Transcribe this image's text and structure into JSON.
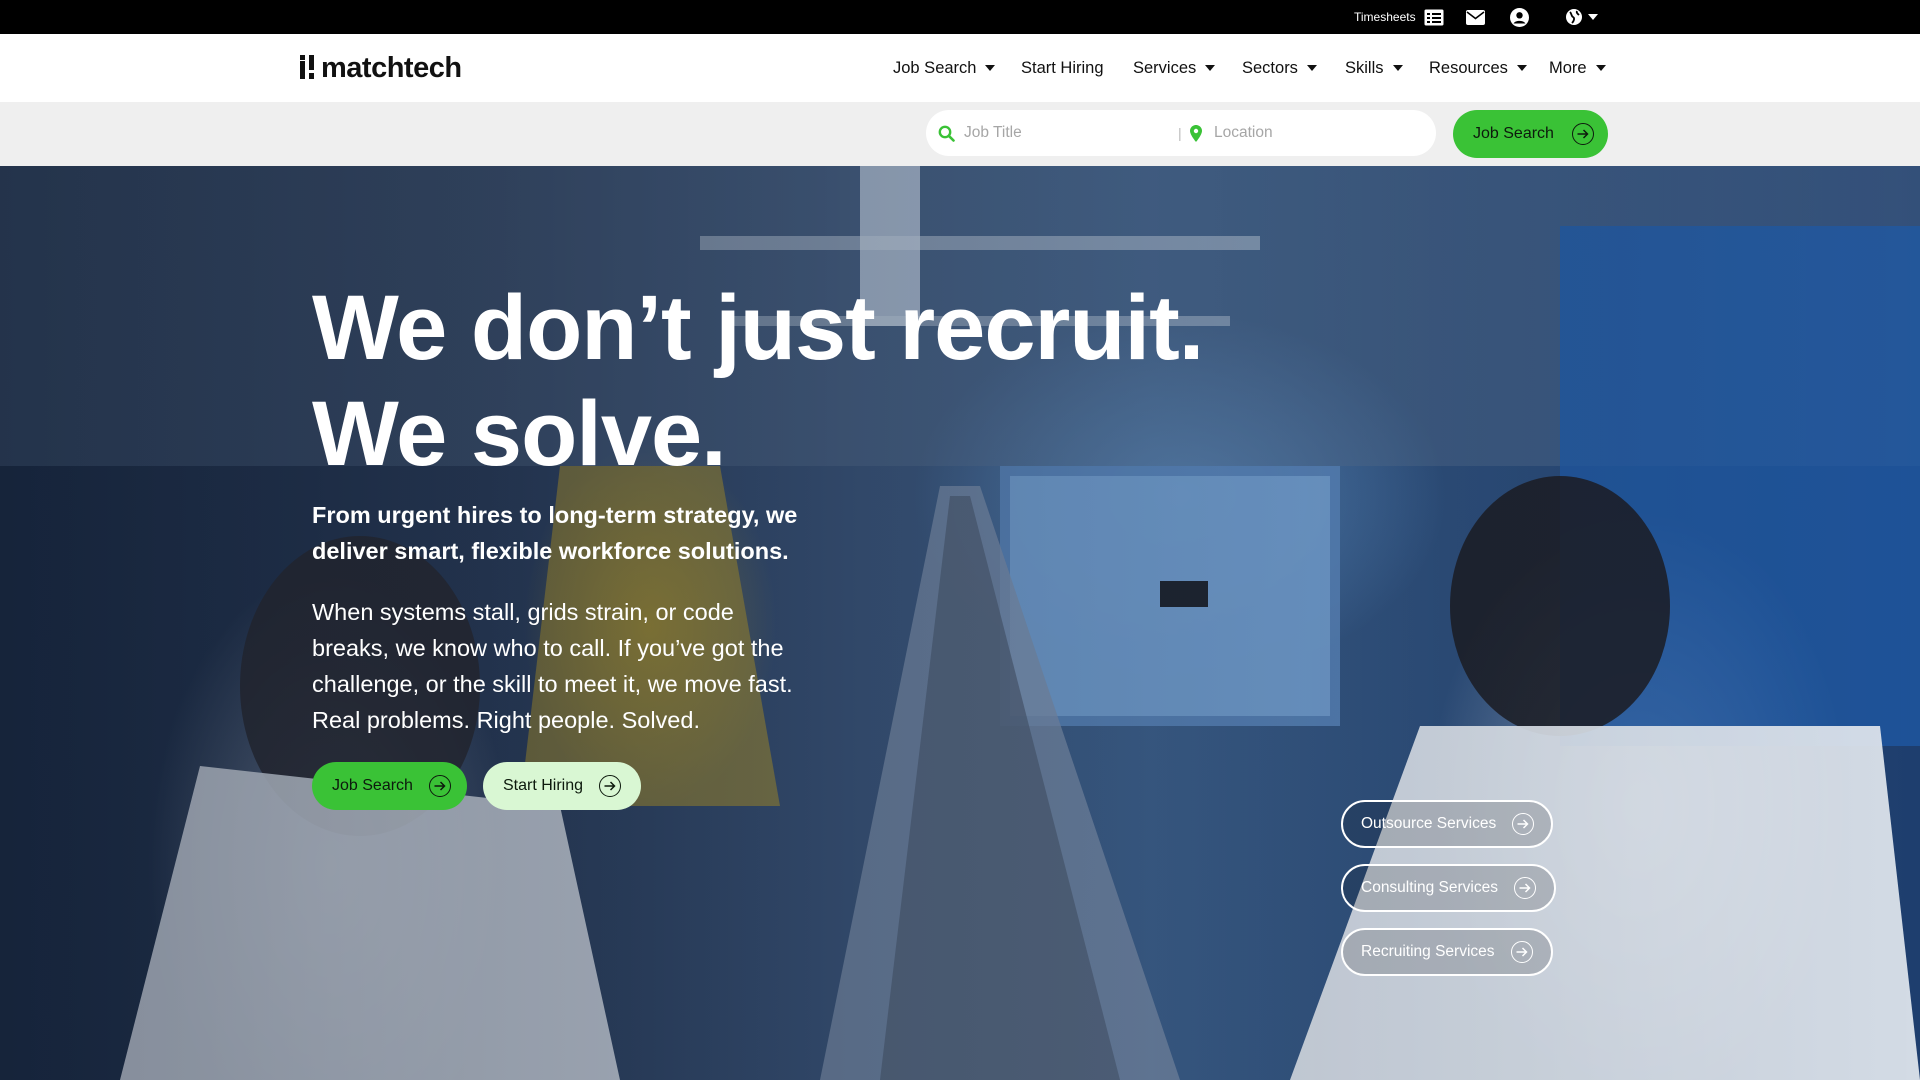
{
  "topbar": {
    "timesheets_label": "Timesheets",
    "icons": [
      "timesheets-icon",
      "mail-icon",
      "account-icon",
      "globe-icon"
    ]
  },
  "header": {
    "logo_text": "matchtech",
    "nav": [
      {
        "label": "Job Search",
        "dropdown": true
      },
      {
        "label": "Start Hiring",
        "dropdown": false
      },
      {
        "label": "Services",
        "dropdown": true
      },
      {
        "label": "Sectors",
        "dropdown": true
      },
      {
        "label": "Skills",
        "dropdown": true
      },
      {
        "label": "Resources",
        "dropdown": true
      },
      {
        "label": "More",
        "dropdown": true
      }
    ]
  },
  "search": {
    "job_title_placeholder": "Job Title",
    "divider": "|",
    "location_placeholder": "Location",
    "button_label": "Job Search"
  },
  "hero": {
    "headline_line1": "We don’t just recruit.",
    "headline_line2": "We solve.",
    "subhead": "From urgent hires to long-term strategy, we deliver smart, flexible workforce solutions.",
    "body": "When systems stall, grids strain, or code breaks, we know who to call. If you’ve got the challenge, or the skill to meet it, we move fast. Real problems. Right people. Solved.",
    "cta_job": "Job Search",
    "cta_hire": "Start Hiring",
    "services": [
      "Outsource Services",
      "Consulting Services",
      "Recruiting Services"
    ]
  },
  "colors": {
    "accent_green": "#3ac236",
    "light_green": "#d9f7d3",
    "topbar_bg": "#000000",
    "search_strip_bg": "#efefef"
  }
}
